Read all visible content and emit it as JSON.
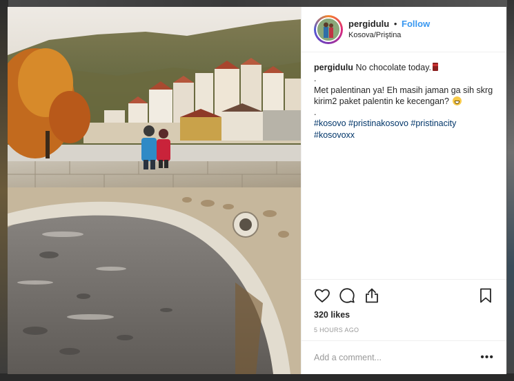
{
  "post": {
    "username": "pergidulu",
    "separator": "•",
    "follow_label": "Follow",
    "location": "Kosova/Priştina"
  },
  "caption": {
    "username": "pergidulu",
    "line1": "No chocolate today.",
    "dot1": ".",
    "line2": "Met palentinan ya! Eh masih jaman ga sih skrg kirim2 paket palentin ke kecengan?",
    "dot2": ".",
    "hashtags": [
      "#kosovo",
      "#pristinakosovo",
      "#pristinacity",
      "#kosovoxx"
    ]
  },
  "engagement": {
    "likes": "320 likes",
    "timestamp": "5 HOURS AGO"
  },
  "comment": {
    "placeholder": "Add a comment..."
  },
  "icons": {
    "like": "heart-icon",
    "comment": "comment-icon",
    "share": "share-icon",
    "save": "bookmark-icon",
    "more": "more-options-icon"
  },
  "colors": {
    "link": "#3897f0",
    "hashtag": "#003569",
    "text": "#262626",
    "muted": "#999999"
  }
}
